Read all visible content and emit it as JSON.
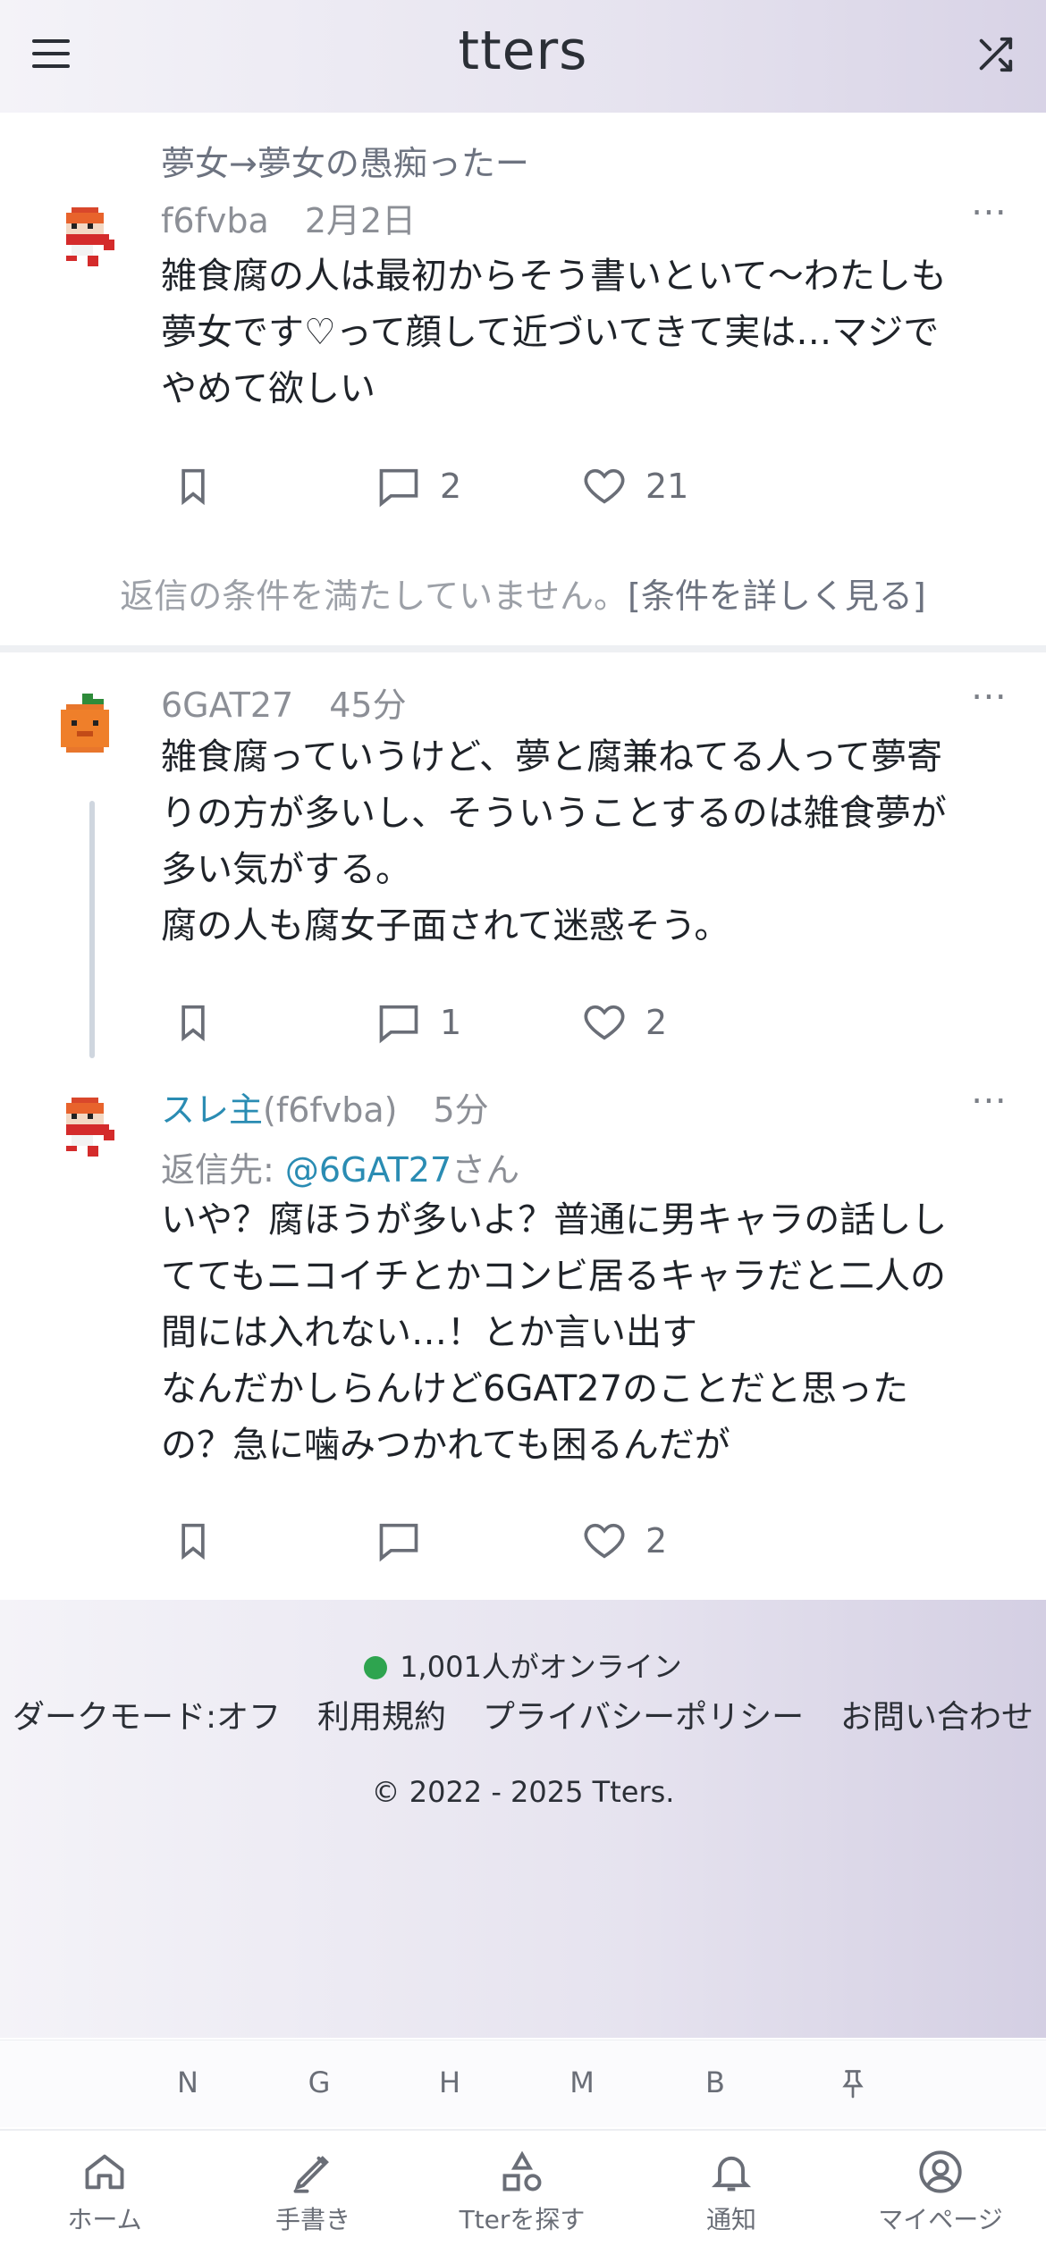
{
  "header": {
    "logo": "tters"
  },
  "posts": [
    {
      "topic": "夢女→夢女の愚痴ったー",
      "author": "f6fvba",
      "time": "2月2日",
      "body": "雑食腐の人は最初からそう書いといて〜わたしも夢女です♡って顔して近づいてきて実は…マジでやめて欲しい",
      "comments": "2",
      "likes": "21",
      "notice": "返信の条件を満たしていません。",
      "notice_link": "[条件を詳しく見る]"
    },
    {
      "author": "6GAT27",
      "time": "45分",
      "body": "雑食腐っていうけど、夢と腐兼ねてる人って夢寄りの方が多いし、そういうことするのは雑食夢が多い気がする。\n腐の人も腐女子面されて迷惑そう。",
      "comments": "1",
      "likes": "2"
    },
    {
      "author_prefix": "スレ主",
      "author": "(f6fvba)",
      "time": "5分",
      "reply_label": "返信先: ",
      "reply_to": "@6GAT27",
      "reply_suffix": "さん",
      "body": "いや？腐ほうが多いよ？普通に男キャラの話ししててもニコイチとかコンビ居るキャラだと二人の間には入れない…！とか言い出す\nなんだかしらんけど6GAT27のことだと思ったの？急に噛みつかれても困るんだが",
      "likes": "2"
    }
  ],
  "footer": {
    "online": "1,001人がオンライン",
    "links": [
      "ダークモード:オフ",
      "利用規約",
      "プライバシーポリシー",
      "お問い合わせ"
    ],
    "copyright": "© 2022 - 2025 Tters."
  },
  "shortcut_keys": [
    "N",
    "G",
    "H",
    "M",
    "B"
  ],
  "nav": [
    {
      "label": "ホーム",
      "icon": "home-icon"
    },
    {
      "label": "手書き",
      "icon": "pen-icon"
    },
    {
      "label": "Tterを探す",
      "icon": "shapes-icon"
    },
    {
      "label": "通知",
      "icon": "bell-icon"
    },
    {
      "label": "マイページ",
      "icon": "user-circle-icon"
    }
  ],
  "colors": {
    "accent": "#2a8cb3",
    "online": "#2ea44f"
  }
}
